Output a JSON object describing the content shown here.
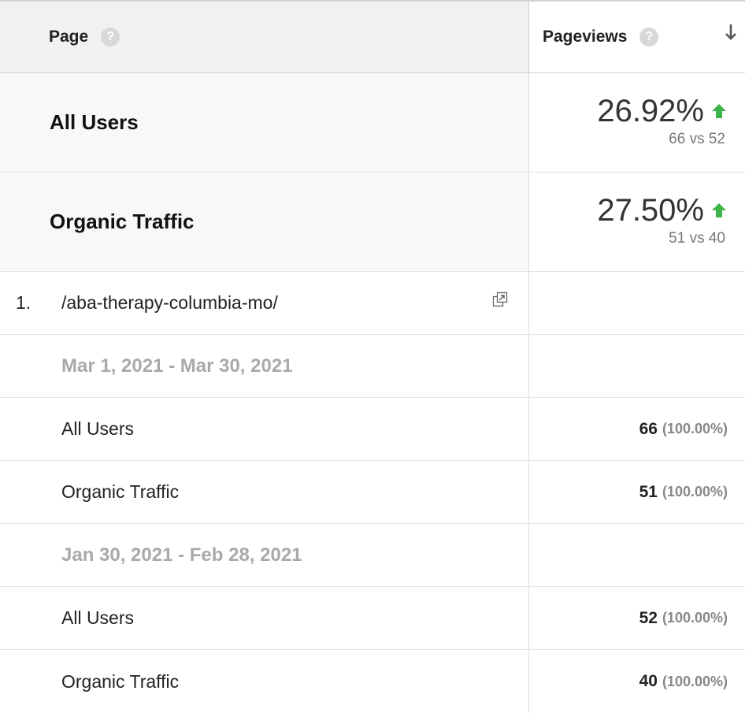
{
  "header": {
    "page_label": "Page",
    "pageviews_label": "Pageviews",
    "help_glyph": "?",
    "sort_icon": "arrow-down-icon"
  },
  "summary": [
    {
      "label": "All Users",
      "percent": "26.92%",
      "compare": "66 vs 52",
      "trend": "up"
    },
    {
      "label": "Organic Traffic",
      "percent": "27.50%",
      "compare": "51 vs 40",
      "trend": "up"
    }
  ],
  "page_row": {
    "index": "1.",
    "path": "/aba-therapy-columbia-mo/",
    "icon": "open-in-new-window-icon"
  },
  "groups": [
    {
      "date_range": "Mar 1, 2021 - Mar 30, 2021",
      "rows": [
        {
          "segment": "All Users",
          "value": "66",
          "share": "(100.00%)"
        },
        {
          "segment": "Organic Traffic",
          "value": "51",
          "share": "(100.00%)"
        }
      ]
    },
    {
      "date_range": "Jan 30, 2021 - Feb 28, 2021",
      "rows": [
        {
          "segment": "All Users",
          "value": "52",
          "share": "(100.00%)"
        },
        {
          "segment": "Organic Traffic",
          "value": "40",
          "share": "(100.00%)"
        }
      ]
    }
  ],
  "colors": {
    "trend_up": "#3db54a",
    "header_bg": "#f1f1f1",
    "muted_text": "#a9a9a9"
  }
}
